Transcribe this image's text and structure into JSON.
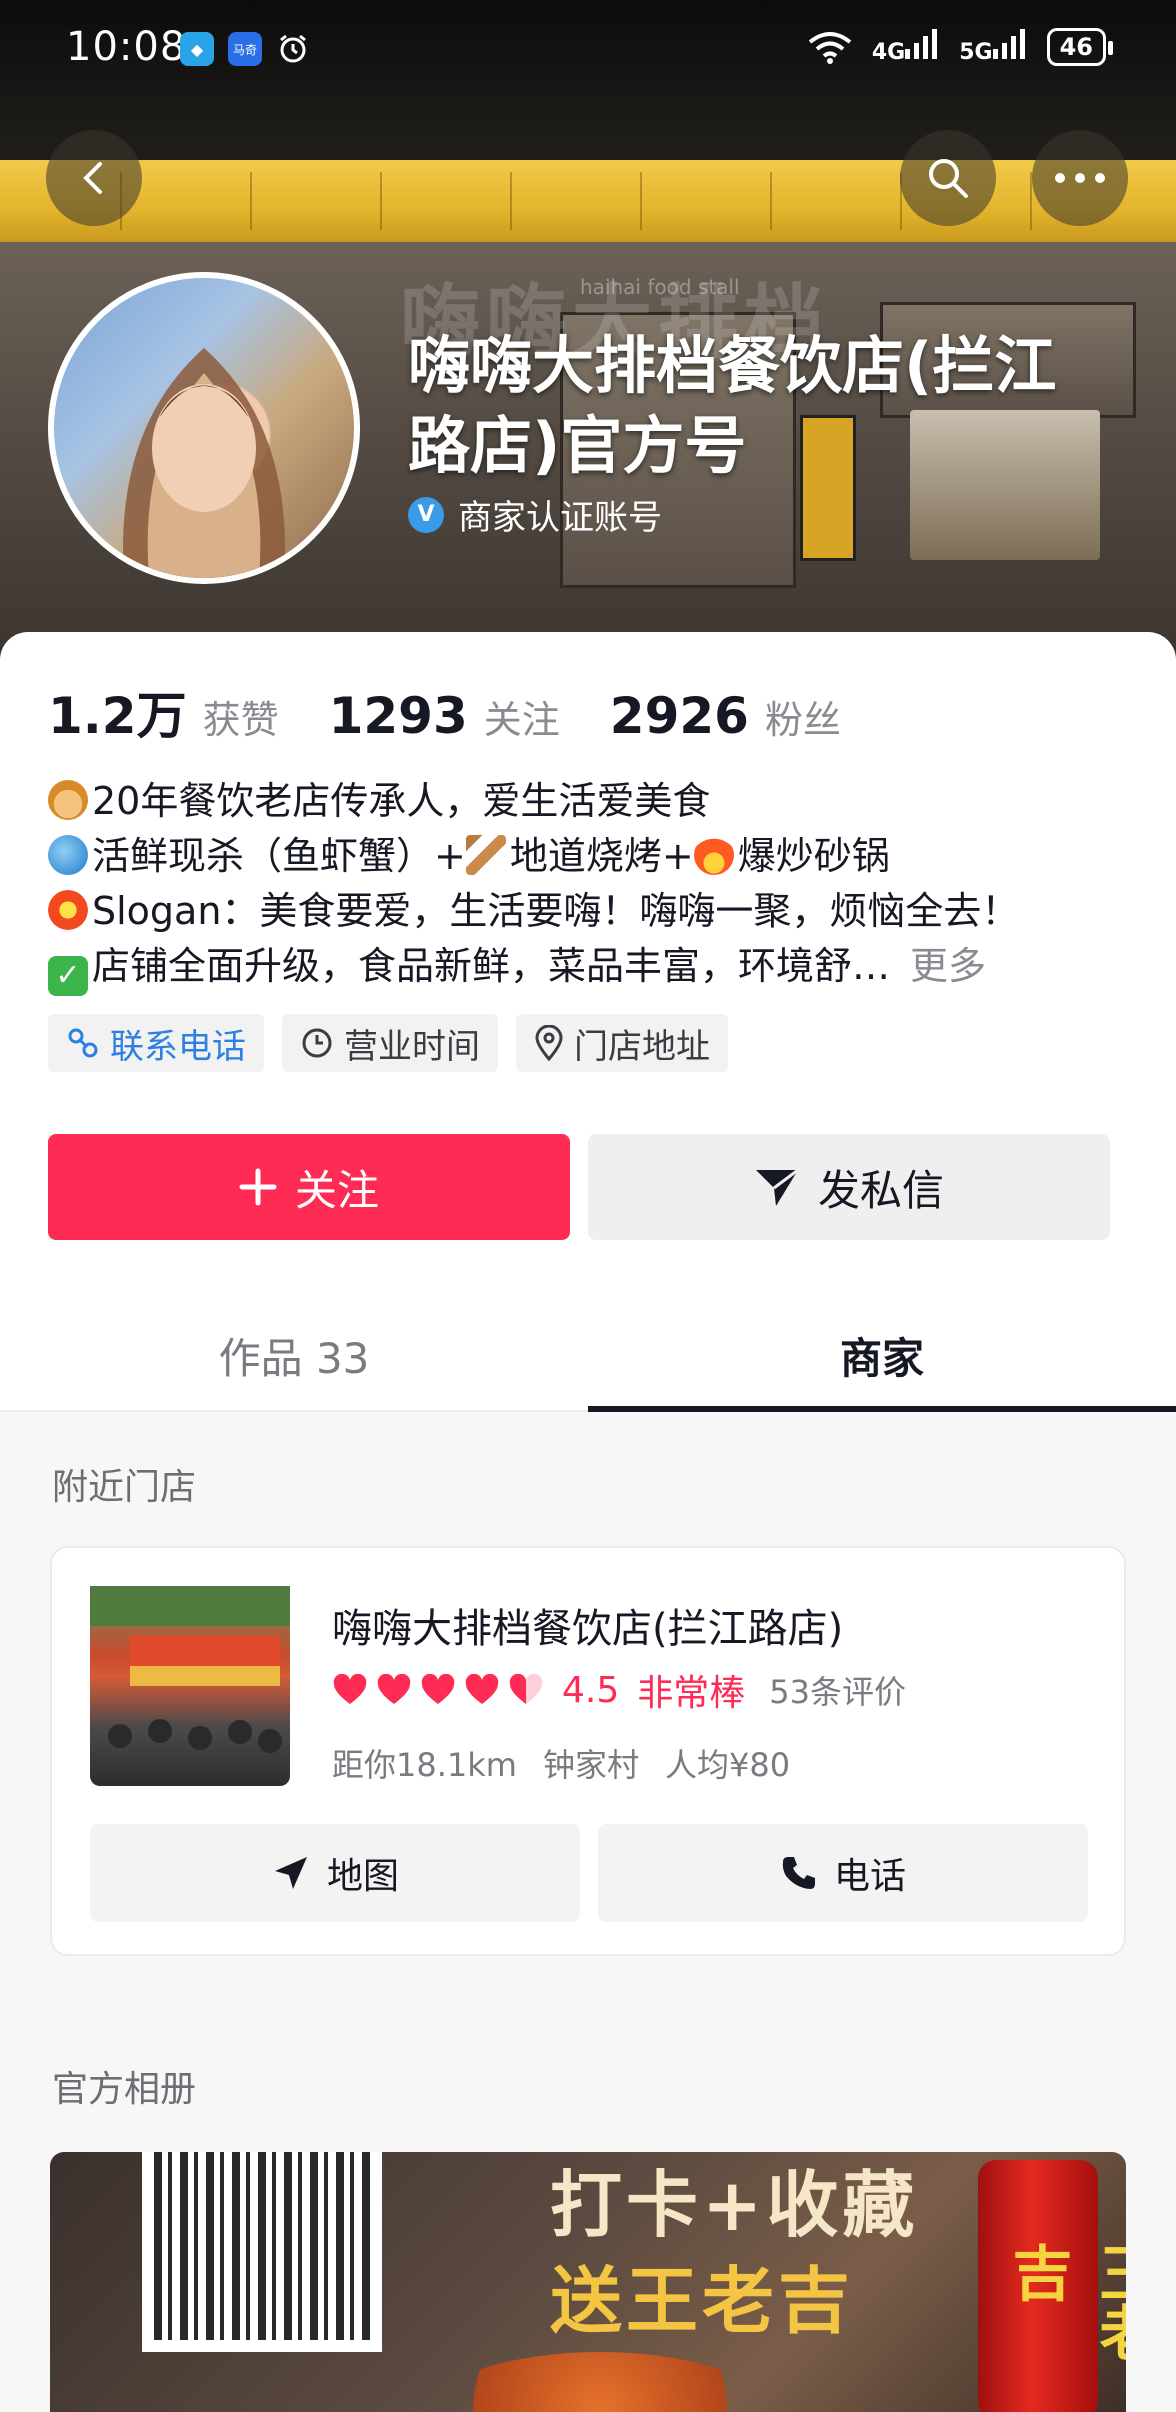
{
  "status_bar": {
    "time": "10:08",
    "app_label": "马奇",
    "signal_1": "4G",
    "signal_2": "5G",
    "battery": "46"
  },
  "header": {
    "profile_name": "嗨嗨大排档餐饮店(拦江路店)官方号",
    "verified_badge": "V",
    "verified_label": "商家认证账号",
    "banner_shop_text": "嗨嗨大排档",
    "banner_shop_sub": "haihai food stall"
  },
  "stats": [
    {
      "num": "1.2万",
      "label": "获赞"
    },
    {
      "num": "1293",
      "label": "关注"
    },
    {
      "num": "2926",
      "label": "粉丝"
    }
  ],
  "bio": {
    "line1": "20年餐饮老店传承人，爱生活爱美食",
    "line2a": "活鲜现杀（鱼虾蟹）+",
    "line2b": "地道烧烤+",
    "line2c": "爆炒砂锅",
    "line3": "Slogan：美食要爱，生活要嗨！嗨嗨一聚，烦恼全去！",
    "line4": "店铺全面升级，食品新鲜，菜品丰富，环境舒…",
    "more": "更多"
  },
  "chips": {
    "phone": "联系电话",
    "hours": "营业时间",
    "address": "门店地址"
  },
  "actions": {
    "follow": "关注",
    "message": "发私信"
  },
  "tabs": {
    "works": "作品 33",
    "merchant": "商家"
  },
  "nearby": {
    "title": "附近门店",
    "store_name": "嗨嗨大排档餐饮店(拦江路店)",
    "rating_value": 4.5,
    "score": "4.5",
    "score_word": "非常棒",
    "reviews": "53条评价",
    "distance": "距你18.1km",
    "area": "钟家村",
    "avg_price": "人均¥80",
    "map_btn": "地图",
    "phone_btn": "电话"
  },
  "album": {
    "title": "官方相册",
    "line1": "打卡+收藏",
    "line2": "送王老吉",
    "can_text": "王老吉"
  },
  "colors": {
    "accent": "#fe2c55",
    "link_blue": "#2d7fe0",
    "verified_blue": "#3a9be8"
  }
}
